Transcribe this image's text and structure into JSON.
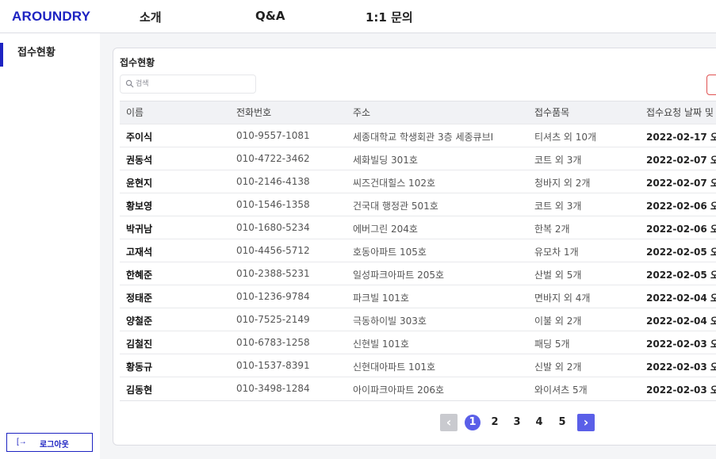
{
  "header": {
    "logo": "AROUNDRY",
    "nav": [
      "소개",
      "Q&A",
      "1:1 문의"
    ]
  },
  "sidebar": {
    "items": [
      {
        "label": "접수현황",
        "active": true
      }
    ],
    "logout_label": "로그아웃",
    "logout_icon": "logout-icon"
  },
  "card": {
    "title": "접수현황",
    "search_placeholder": "검색"
  },
  "table": {
    "columns": [
      "이름",
      "전화번호",
      "주소",
      "접수품목",
      "접수요청 날짜 및"
    ],
    "rows": [
      [
        "주이식",
        "010-9557-1081",
        "세종대학교 학생회관 3층 세종큐브I",
        "티셔츠 외 10개",
        "2022-02-17 오"
      ],
      [
        "권동석",
        "010-4722-3462",
        "세화빌딩 301호",
        "코트 외 3개",
        "2022-02-07 오"
      ],
      [
        "윤현지",
        "010-2146-4138",
        "씨즈건대힐스 102호",
        "청바지 외 2개",
        "2022-02-07 오"
      ],
      [
        "황보영",
        "010-1546-1358",
        "건국대 행정관 501호",
        "코트 외 3개",
        "2022-02-06 오"
      ],
      [
        "박귀남",
        "010-1680-5234",
        "에버그린 204호",
        "한복 2개",
        "2022-02-06 오"
      ],
      [
        "고재석",
        "010-4456-5712",
        "호동아파트 105호",
        "유모차 1개",
        "2022-02-05 오"
      ],
      [
        "한혜준",
        "010-2388-5231",
        "일성파크아파트 205호",
        "산벌 외 5개",
        "2022-02-05 오"
      ],
      [
        "정태준",
        "010-1236-9784",
        "파크빌 101호",
        "면바지 외 4개",
        "2022-02-04 오"
      ],
      [
        "양철준",
        "010-7525-2149",
        "극동하이빌 303호",
        "이불 외 2개",
        "2022-02-04 오"
      ],
      [
        "김철진",
        "010-6783-1258",
        "신현빌 101호",
        "패딩 5개",
        "2022-02-03 오"
      ],
      [
        "황동규",
        "010-1537-8391",
        "신현대아파트 101호",
        "신발 외 2개",
        "2022-02-03 오"
      ],
      [
        "김동현",
        "010-3498-1284",
        "아이파크아파트 206호",
        "와이셔츠 5개",
        "2022-02-03 오"
      ]
    ]
  },
  "pagination": {
    "pages": [
      "1",
      "2",
      "3",
      "4",
      "5"
    ],
    "current": "1",
    "prev_icon": "‹",
    "next_icon": "›"
  },
  "colors": {
    "brand": "#1d23c2",
    "accent": "#5a5fe8",
    "danger": "#e05151"
  }
}
